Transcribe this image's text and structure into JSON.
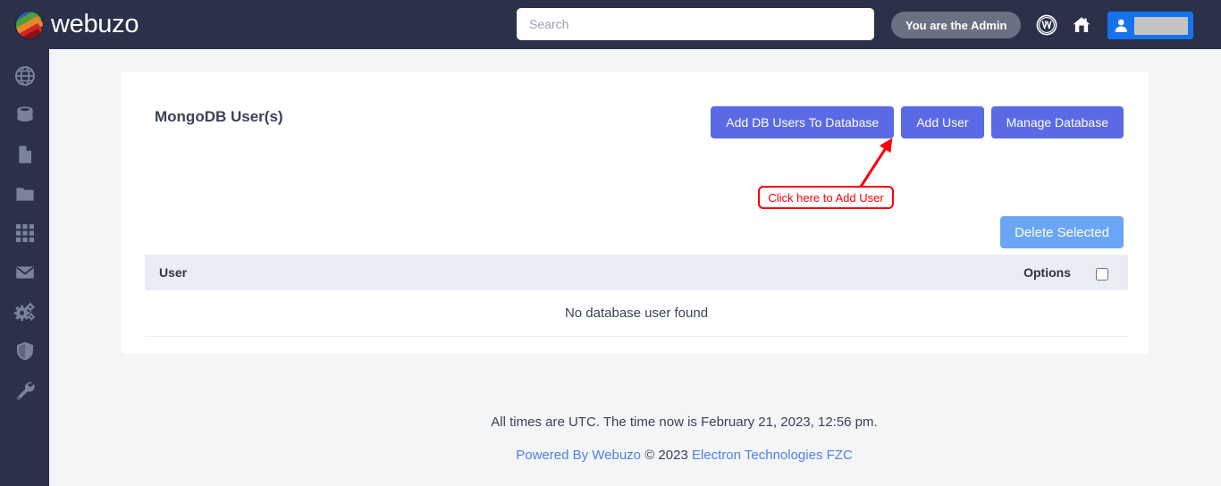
{
  "header": {
    "brand_name": "webuzo",
    "brand_logo_icon": "globe-logo-icon",
    "search": {
      "value": "",
      "placeholder": "Search"
    },
    "admin_pill_label": "You are the Admin",
    "wordpress_icon": "wordpress-icon",
    "home_icon": "home-icon",
    "user_button": {
      "avatar_icon": "user-avatar-icon",
      "username_redacted": ""
    }
  },
  "sidebar": {
    "items": [
      {
        "icon": "globe-icon",
        "label": "Domains"
      },
      {
        "icon": "database-icon",
        "label": "Databases"
      },
      {
        "icon": "file-icon",
        "label": "Files"
      },
      {
        "icon": "folder-icon",
        "label": "Folders"
      },
      {
        "icon": "grid-apps-icon",
        "label": "Apps"
      },
      {
        "icon": "mail-icon",
        "label": "Email"
      },
      {
        "icon": "gears-icon",
        "label": "Settings"
      },
      {
        "icon": "shield-icon",
        "label": "Security"
      },
      {
        "icon": "wrench-icon",
        "label": "Tools"
      }
    ]
  },
  "card": {
    "title": "MongoDB User(s)",
    "buttons": {
      "add_db_users": "Add DB Users To Database",
      "add_user": "Add User",
      "manage_database": "Manage Database",
      "delete_selected": "Delete Selected"
    },
    "table": {
      "columns": {
        "user": "User",
        "options": "Options"
      },
      "select_all_checked": false,
      "rows": [],
      "empty_message": "No database user found"
    }
  },
  "annotation": {
    "label": "Click here to Add User",
    "color": "#fb0007"
  },
  "footer": {
    "time_notice": "All times are UTC. The time now is February 21, 2023, 12:56 pm.",
    "powered_by": "Powered By Webuzo",
    "copyright": " © 2023 ",
    "company": "Electron Technologies FZC"
  },
  "colors": {
    "sidebar_bg": "#2a3149",
    "topbar_bg": "#2a3149",
    "page_bg": "#f4f5f7",
    "primary_button": "#5b6ae4",
    "delete_button": "#6ba5f5",
    "user_button": "#1573f0",
    "annotation_red": "#fb0007",
    "link_blue": "#4f7fe8",
    "table_head_bg": "#eaedf3"
  }
}
